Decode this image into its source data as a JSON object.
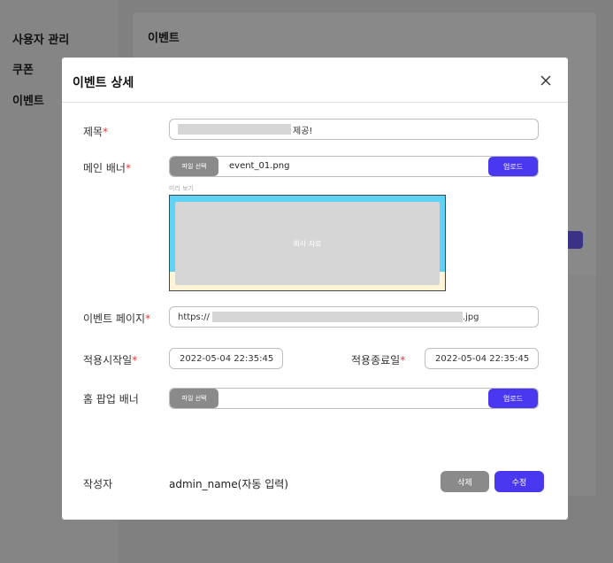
{
  "background": {
    "sidebar": [
      "사용자 관리",
      "쿠폰",
      "이벤트"
    ],
    "main_title": "이벤트"
  },
  "modal": {
    "title": "이벤트 상세",
    "fields": {
      "title_label": "제목",
      "title_value_suffix": "제공!",
      "banner_label": "메인 배너",
      "file_select": "파일 선택",
      "banner_file": "event_01.png",
      "upload": "업로드",
      "preview_label": "미리 보기",
      "preview_text": "회사 자료",
      "page_label": "이벤트 페이지",
      "page_url_prefix": "https://",
      "page_url_suffix": ".jpg",
      "start_label": "적용시작일",
      "start_value": "2022-05-04   22:35:45",
      "end_label": "적용종료일",
      "end_value": "2022-05-04   22:35:45",
      "popup_label": "홈 팝업 배너",
      "author_label": "작성자",
      "author_value": "admin_name(자동 입력)"
    },
    "required_mark": "*",
    "buttons": {
      "delete": "삭제",
      "edit": "수정"
    }
  },
  "colors": {
    "primary": "#4a37f0",
    "secondary": "#8a8a8a",
    "required": "#e53935"
  }
}
